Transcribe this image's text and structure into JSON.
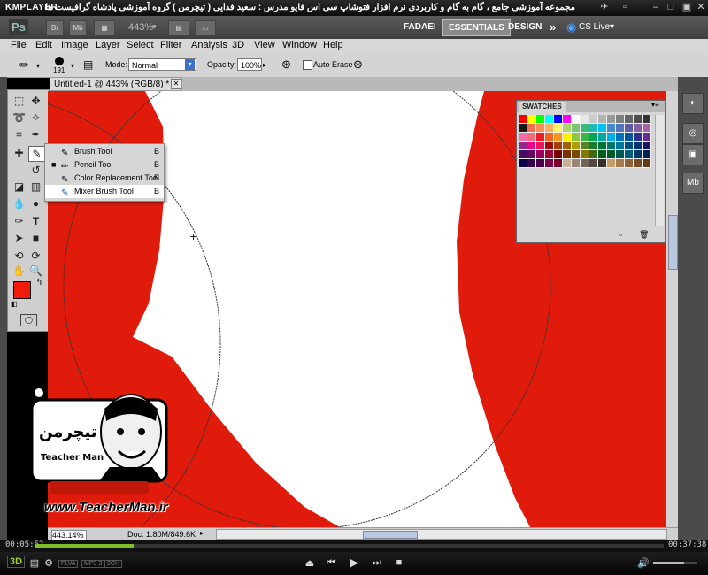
{
  "kmplayer": {
    "logo": "KMPLAYER",
    "title": "مجموعه آموزشی جامع ، گام به گام و کاربردی نرم افزار فتوشاپ سی اس فایو  مدرس : سعید فدایی ( تیچرمن ) گروه آموزشی پادشاه گرافیست ها",
    "time_elapsed": "00:05:52",
    "time_total": "00:37:38",
    "badges": [
      "FLVA",
      "MP3 3",
      "2CH"
    ]
  },
  "appbar": {
    "logo": "Ps",
    "icons": [
      "Br",
      "Mb"
    ],
    "zoom": "443%",
    "workspaces": [
      "FADAEI",
      "ESSENTIALS",
      "DESIGN"
    ],
    "more": "»",
    "cs_live": "CS Live▾"
  },
  "menus": [
    "File",
    "Edit",
    "Image",
    "Layer",
    "Select",
    "Filter",
    "Analysis",
    "3D",
    "View",
    "Window",
    "Help"
  ],
  "options": {
    "brush_size": "191",
    "mode_label": "Mode:",
    "mode_value": "Normal",
    "opacity_label": "Opacity:",
    "opacity_value": "100%",
    "auto_erase_label": "Auto Erase"
  },
  "document": {
    "tab_title": "Untitled-1 @ 443% (RGB/8) *",
    "zoom_status": "443.14%",
    "doc_status": "Doc: 1.80M/849.6K"
  },
  "flyout": {
    "items": [
      {
        "label": "Brush Tool",
        "key": "B",
        "icon": "brush-icon",
        "active": false,
        "glyph": "✎"
      },
      {
        "label": "Pencil Tool",
        "key": "B",
        "icon": "pencil-icon",
        "active": true,
        "glyph": "✏"
      },
      {
        "label": "Color Replacement Tool",
        "key": "B",
        "icon": "color-replacement-icon",
        "active": false,
        "glyph": "✎"
      },
      {
        "label": "Mixer Brush Tool",
        "key": "B",
        "icon": "mixer-brush-icon",
        "active": false,
        "glyph": "✎"
      }
    ]
  },
  "swatches": {
    "title": "SWATCHES",
    "colors": [
      "#ff0000",
      "#ffff00",
      "#00ff00",
      "#00ffff",
      "#0000ff",
      "#ff00ff",
      "#ffffff",
      "#e6e6e6",
      "#cccccc",
      "#b3b3b3",
      "#999999",
      "#808080",
      "#666666",
      "#4d4d4d",
      "#333333",
      "#1a1a1a",
      "#f26c4f",
      "#f68e55",
      "#fbaf5d",
      "#fff467",
      "#acd372",
      "#7cc576",
      "#3bb878",
      "#1abbb4",
      "#00bff3",
      "#438ccb",
      "#5574b9",
      "#605ca8",
      "#855fa8",
      "#a763a8",
      "#f06ea9",
      "#f26d7d",
      "#ed1c24",
      "#f26522",
      "#f7941d",
      "#fff200",
      "#8dc73f",
      "#39b54a",
      "#00a651",
      "#00a99d",
      "#00aeef",
      "#0072bc",
      "#0054a6",
      "#2e3192",
      "#662d91",
      "#92278f",
      "#ec008c",
      "#ed145b",
      "#9e0b0f",
      "#a0410d",
      "#a36209",
      "#aba000",
      "#598527",
      "#1a7b30",
      "#007236",
      "#00746b",
      "#0076a3",
      "#004b80",
      "#003471",
      "#1b1464",
      "#440e62",
      "#630460",
      "#9e005d",
      "#9e0039",
      "#790000",
      "#7b2e00",
      "#7d4900",
      "#827b00",
      "#406618",
      "#005e20",
      "#005826",
      "#005952",
      "#005b7f",
      "#003663",
      "#002157",
      "#0d004c",
      "#32004b",
      "#4b0049",
      "#7b0046",
      "#7a0026",
      "#c7b299",
      "#998675",
      "#736357",
      "#534741",
      "#37302a",
      "#c69c6d",
      "#a67c52",
      "#8c6239",
      "#754c24",
      "#603913"
    ]
  },
  "watermark": {
    "site": "www.TeacherMan.ir",
    "logo_label": "Teacher Man"
  },
  "dock_icons": [
    "color-icon",
    "adjustments-icon",
    "masks-icon",
    "layers-icon",
    "mini-bridge-icon"
  ]
}
